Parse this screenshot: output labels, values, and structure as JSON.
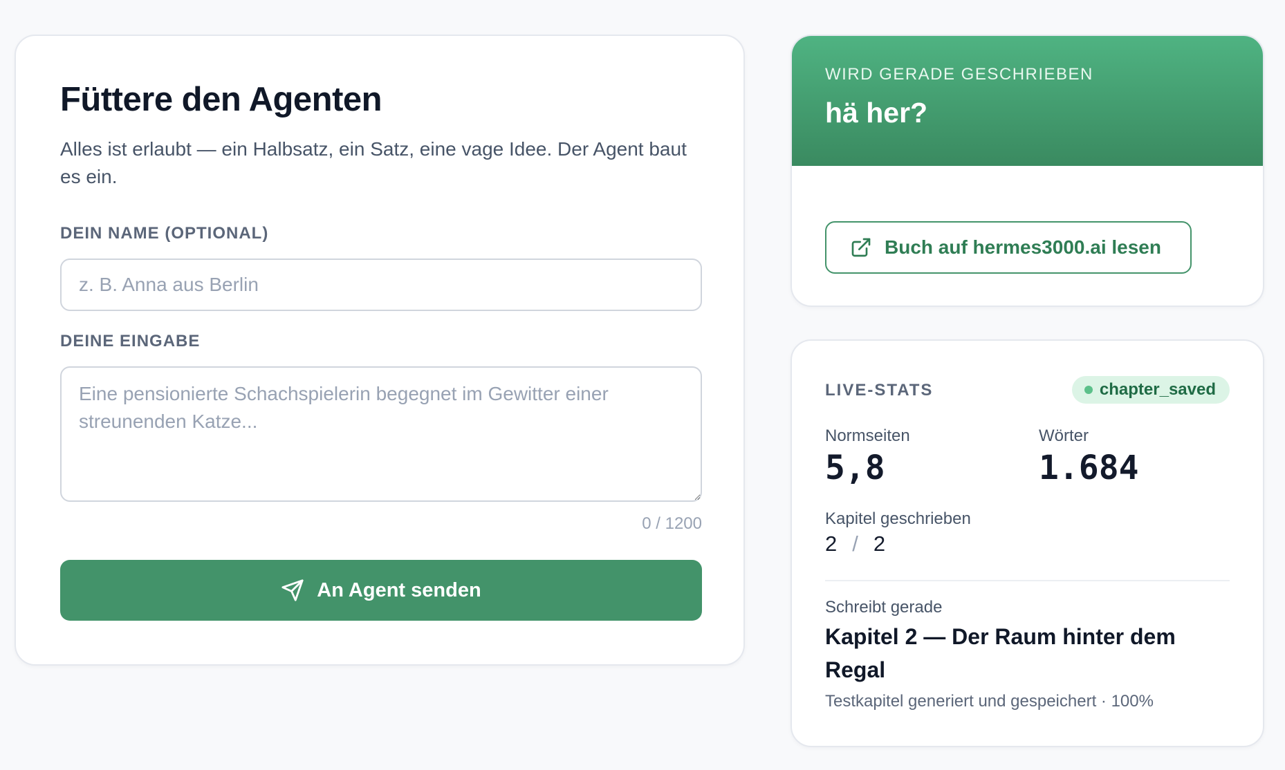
{
  "form": {
    "title": "Füttere den Agenten",
    "subtitle": "Alles ist erlaubt — ein Halbsatz, ein Satz, eine vage Idee. Der Agent baut es ein.",
    "name_label": "DEIN NAME (OPTIONAL)",
    "name_placeholder": "z. B. Anna aus Berlin",
    "name_value": "",
    "input_label": "DEINE EINGABE",
    "input_placeholder": "Eine pensionierte Schachspielerin begegnet im Gewitter einer streunenden Katze...",
    "input_value": "",
    "char_count": "0 / 1200",
    "send_label": "An Agent senden",
    "send_icon": "send-icon"
  },
  "status": {
    "eyebrow": "WIRD GERADE GESCHRIEBEN",
    "title": "hä her?",
    "link_label": "Buch auf hermes3000.ai lesen",
    "link_icon": "external-link-icon"
  },
  "stats": {
    "eyebrow": "LIVE-STATS",
    "badge": "chapter_saved",
    "normseiten_label": "Normseiten",
    "normseiten_value": "5,8",
    "woerter_label": "Wörter",
    "woerter_value": "1.684",
    "chapters_label": "Kapitel geschrieben",
    "chapters_done": "2",
    "chapters_sep": "/",
    "chapters_total": "2",
    "writing_label": "Schreibt gerade",
    "writing_title": "Kapitel 2 — Der Raum hinter dem Regal",
    "writing_meta": "Testkapitel generiert und gespeichert · 100%"
  },
  "colors": {
    "accent": "#43936a",
    "accent_dark": "#2f7d54",
    "badge_bg": "#dcf4e6",
    "page_bg": "#f8f9fb"
  }
}
